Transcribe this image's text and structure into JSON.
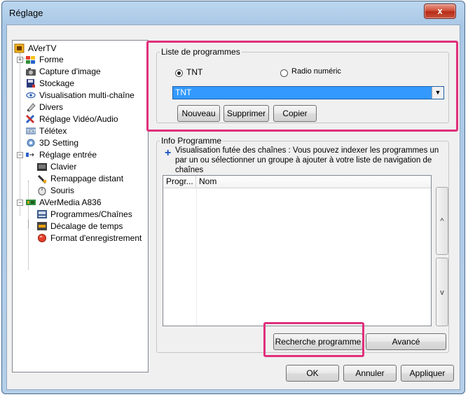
{
  "window": {
    "title": "Réglage",
    "close_label": "x"
  },
  "tree": {
    "items": [
      {
        "label": "AVerTV",
        "icon": "avertv-icon"
      },
      {
        "label": "Forme",
        "icon": "skin-icon"
      },
      {
        "label": "Capture d'image",
        "icon": "camera-icon"
      },
      {
        "label": "Stockage",
        "icon": "storage-icon"
      },
      {
        "label": "Visualisation multi-chaîne",
        "icon": "eye-icon"
      },
      {
        "label": "Divers",
        "icon": "pen-icon"
      },
      {
        "label": "Réglage Vidéo/Audio",
        "icon": "tools-icon"
      },
      {
        "label": "Télétex",
        "icon": "teletext-icon"
      },
      {
        "label": "3D Setting",
        "icon": "gear-icon"
      },
      {
        "label": "Réglage entrée",
        "icon": "input-icon"
      },
      {
        "label": "Clavier",
        "icon": "keyboard-icon"
      },
      {
        "label": "Remappage distant",
        "icon": "remote-icon"
      },
      {
        "label": "Souris",
        "icon": "mouse-icon"
      },
      {
        "label": "AVerMedia A836",
        "icon": "device-icon"
      },
      {
        "label": "Programmes/Chaînes",
        "icon": "channels-icon"
      },
      {
        "label": "Décalage de temps",
        "icon": "timeshift-icon"
      },
      {
        "label": "Format d'enregistrement",
        "icon": "record-icon"
      }
    ]
  },
  "program_list": {
    "group_label": "Liste de programmes",
    "radio_tnt": "TNT",
    "radio_radio": "Radio numéric",
    "selected_source": "TNT",
    "btn_new": "Nouveau",
    "btn_delete": "Supprimer",
    "btn_copy": "Copier"
  },
  "program_info": {
    "group_label": "Info Programme",
    "hint": "Visualisation futée des chaînes : Vous pouvez indexer les programmes un par un ou sélectionner un groupe à ajouter à votre liste de navigation de chaînes",
    "col_prog": "Progr...",
    "col_name": "Nom",
    "scroll_up": "^",
    "scroll_down": "v",
    "btn_search": "Recherche programme",
    "btn_advanced": "Avancé"
  },
  "footer": {
    "btn_ok": "OK",
    "btn_cancel": "Annuler",
    "btn_apply": "Appliquer"
  },
  "colors": {
    "highlight": "#e0307c",
    "selection": "#3399ff"
  }
}
